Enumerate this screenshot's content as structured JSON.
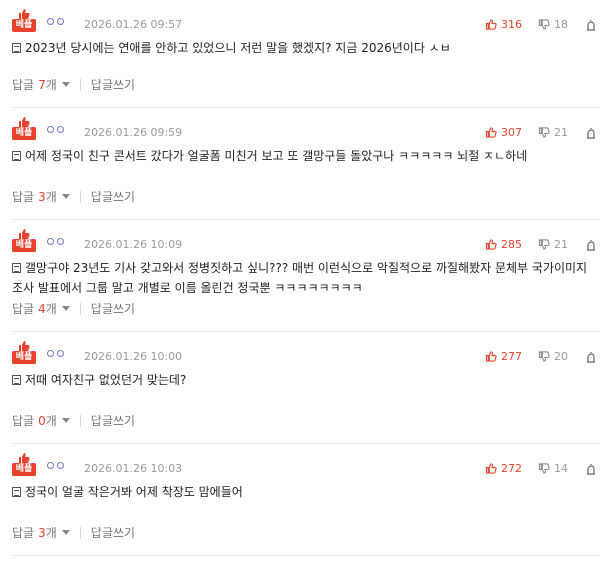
{
  "best_badge": "베플",
  "reply_label": "답글",
  "count_suffix": "개",
  "write_reply_label": "답글쓰기",
  "comments": [
    {
      "date": "2026.01.26 09:57",
      "up": "316",
      "down": "18",
      "text": "2023년 당시에는 연애를 안하고 있었으니 저런 말을 했겠지? 지금 2026년이다 ㅅㅂ",
      "reply_count": "7"
    },
    {
      "date": "2026.01.26 09:59",
      "up": "307",
      "down": "21",
      "text": "어제 정국이 친구 콘서트 갔다가 얼굴폼 미친거 보고 또 갤망구들 돌았구나 ㅋㅋㅋㅋㅋ 뇌절 ㅈㄴ하네",
      "reply_count": "3"
    },
    {
      "date": "2026.01.26 10:09",
      "up": "285",
      "down": "21",
      "text": "갤망구야 23년도 기사 갖고와서 정병짓하고 싶니??? 매번 이런식으로 악질적으로 까질해봤자 문체부 국가이미지 조사 발표에서 그룹 말고 개별로 이름 올린건 정국뿐 ㅋㅋㅋㅋㅋㅋㅋㅋ",
      "reply_count": "4"
    },
    {
      "date": "2026.01.26 10:00",
      "up": "277",
      "down": "20",
      "text": "저때 여자친구 없었던거 맞는데?",
      "reply_count": "0"
    },
    {
      "date": "2026.01.26 10:03",
      "up": "272",
      "down": "14",
      "text": "정국이 얼굴 작은거봐 어제 착장도 맘에들어",
      "reply_count": "3"
    }
  ]
}
